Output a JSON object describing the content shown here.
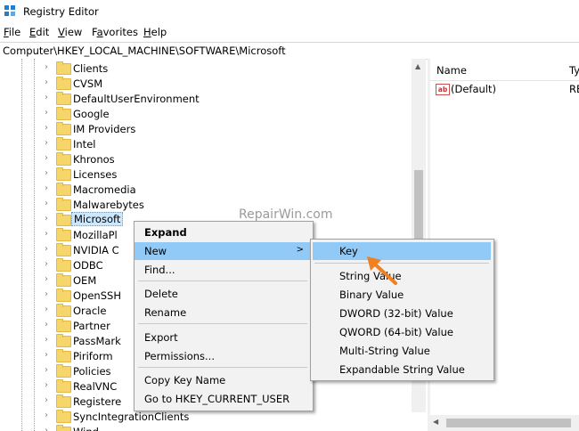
{
  "window": {
    "title": "Registry Editor"
  },
  "menubar": {
    "items": [
      {
        "key": "F",
        "rest": "ile"
      },
      {
        "key": "E",
        "rest": "dit"
      },
      {
        "key": "V",
        "rest": "iew"
      },
      {
        "key": "",
        "pre": "F",
        "key2": "a",
        "rest": "vorites"
      },
      {
        "key": "H",
        "rest": "elp"
      }
    ]
  },
  "address": {
    "path": "Computer\\HKEY_LOCAL_MACHINE\\SOFTWARE\\Microsoft"
  },
  "tree": {
    "items": [
      "Clients",
      "CVSM",
      "DefaultUserEnvironment",
      "Google",
      "IM Providers",
      "Intel",
      "Khronos",
      "Licenses",
      "Macromedia",
      "Malwarebytes",
      "Microsoft",
      "MozillaPl",
      "NVIDIA C",
      "ODBC",
      "OEM",
      "OpenSSH",
      "Oracle",
      "Partner",
      "PassMark",
      "Piriform",
      "Policies",
      "RealVNC",
      "Registere",
      "SyncIntegrationClients",
      "Wind"
    ],
    "selected": "Microsoft"
  },
  "values_pane": {
    "columns": {
      "name": "Name",
      "type": "Ty"
    },
    "rows": [
      {
        "name": "(Default)",
        "type": "RE"
      }
    ]
  },
  "context_menu": {
    "items": [
      {
        "label": "Expand",
        "bold": true
      },
      {
        "label": "New",
        "submenu": true
      },
      {
        "label": "Find..."
      },
      {
        "label": "Delete"
      },
      {
        "label": "Rename"
      },
      {
        "label": "Export"
      },
      {
        "label": "Permissions..."
      },
      {
        "label": "Copy Key Name"
      },
      {
        "label": "Go to HKEY_CURRENT_USER"
      }
    ]
  },
  "new_submenu": {
    "items": [
      "Key",
      "String Value",
      "Binary Value",
      "DWORD (32-bit) Value",
      "QWORD (64-bit) Value",
      "Multi-String Value",
      "Expandable String Value"
    ]
  },
  "watermark": "RepairWin.com",
  "colors": {
    "highlight": "#91c9f7",
    "selection": "#cce8ff",
    "folder": "#f6d56b",
    "cursor": "#f08020"
  }
}
